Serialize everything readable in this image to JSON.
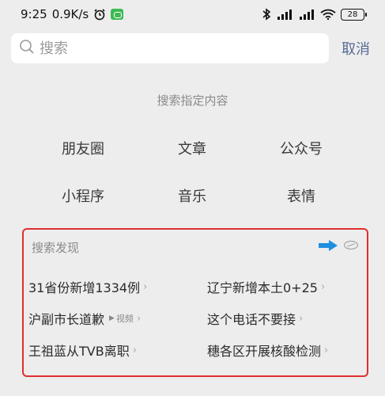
{
  "status_bar": {
    "time": "9:25",
    "speed": "0.9K/s",
    "battery": "28"
  },
  "search": {
    "placeholder": "搜索",
    "cancel_label": "取消"
  },
  "specified": {
    "title": "搜索指定内容",
    "items": [
      "朋友圈",
      "文章",
      "公众号",
      "小程序",
      "音乐",
      "表情"
    ]
  },
  "discovery": {
    "title": "搜索发现",
    "items": [
      {
        "label": "31省份新增1334例",
        "tag": ""
      },
      {
        "label": "辽宁新增本土0+25",
        "tag": ""
      },
      {
        "label": "沪副市长道歉",
        "tag": "视频"
      },
      {
        "label": "这个电话不要接",
        "tag": ""
      },
      {
        "label": "王祖蓝从TVB离职",
        "tag": ""
      },
      {
        "label": "穗各区开展核酸检测",
        "tag": ""
      }
    ],
    "accent_color": "#1e8ee0",
    "highlight_color": "#e03030"
  },
  "icons": [
    "alarm-icon",
    "bluetooth-icon",
    "signal-icon",
    "wifi-icon",
    "battery-icon",
    "search-icon",
    "arrow-right-icon",
    "hide-eye-icon",
    "chevron-right-icon"
  ]
}
